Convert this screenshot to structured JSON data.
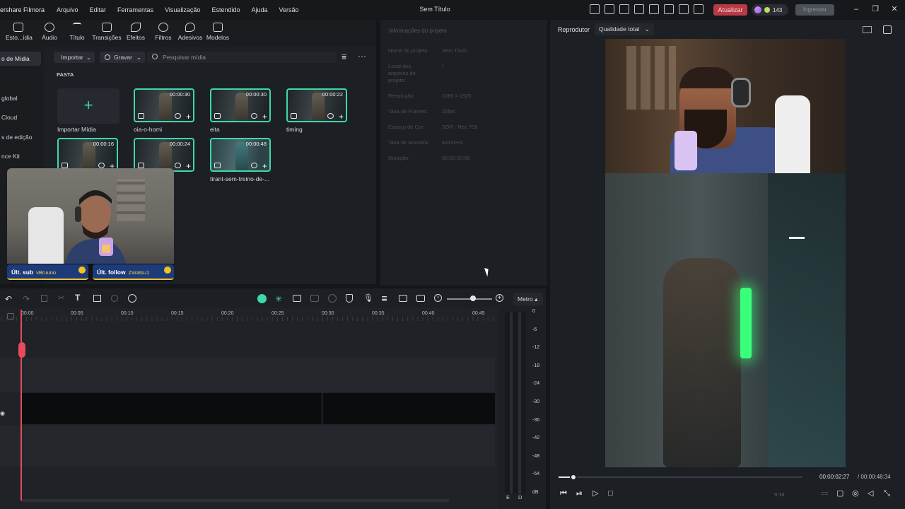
{
  "app": {
    "brand": "ershare Filmora",
    "menus": [
      "Arquivo",
      "Editar",
      "Ferramentas",
      "Visualização",
      "Estendido",
      "Ajuda",
      "Versão"
    ],
    "window_title": "Sem Título",
    "update_label": "Atualizar",
    "credits": "143",
    "login_label": "Ingressar"
  },
  "toolbar": {
    "items": [
      "Esto...ídia",
      "Áudio",
      "Título",
      "Transições",
      "Efeitos",
      "Filtros",
      "Adesivos",
      "Modelos"
    ]
  },
  "media": {
    "sidebar": [
      "o de Mídia",
      "global",
      "Cloud",
      "s de edição",
      "nce Kit"
    ],
    "import_dropdown": "Importar",
    "record_dropdown": "Gravar",
    "search_placeholder": "Pesquisar mídia",
    "folder_label": "PASTA",
    "import_tile_label": "Importar Mídia",
    "clips": [
      {
        "duration": "00:00:30",
        "name": "oia-o-homi"
      },
      {
        "duration": "00:00:30",
        "name": "eita"
      },
      {
        "duration": "00:00:22",
        "name": "timing"
      },
      {
        "duration": "00:00:16",
        "name": ""
      },
      {
        "duration": "00:00:24",
        "name": ""
      },
      {
        "duration": "00:00:48",
        "name": "tirant-sem-treino-de-..."
      }
    ]
  },
  "webcam": {
    "sub_label": "Últ. sub",
    "sub_name": "vBruuno",
    "follow_label": "Últ. follow",
    "follow_name": "Zaratsu1"
  },
  "project_info": {
    "title": "Informações do projeto",
    "rows": [
      {
        "k": "Nome do projeto:",
        "v": "Sem Título"
      },
      {
        "k": "Local dos arquivos do projeto:",
        "v": "/"
      },
      {
        "k": "Resolução:",
        "v": "1080 x 1920"
      },
      {
        "k": "Taxa de Frames:",
        "v": "25fps"
      },
      {
        "k": "Espaço de Cor:",
        "v": "SDR - Rec.709"
      },
      {
        "k": "Taxa de Amostra:",
        "v": "44100Hz"
      },
      {
        "k": "Duração:",
        "v": "00:00:00:00"
      }
    ]
  },
  "preview": {
    "player_label": "Reprodutor",
    "quality_label": "Qualidade total",
    "current_time": "00:00:02:27",
    "total_time": "/  00:00:48:34",
    "aspect_label": "9:16",
    "progress_fraction": 0.06
  },
  "timeline": {
    "meter_label": "Metro",
    "ruler": [
      "00:00",
      "00:05",
      "00:10",
      "00:15",
      "00:20",
      "00:25",
      "00:30",
      "00:35",
      "00:40",
      "00:45"
    ],
    "db_scale": [
      "0",
      "-6",
      "-12",
      "-18",
      "-24",
      "-30",
      "-36",
      "-42",
      "-48",
      "-54",
      "dB"
    ],
    "meter_channels": [
      "E",
      "D"
    ]
  }
}
